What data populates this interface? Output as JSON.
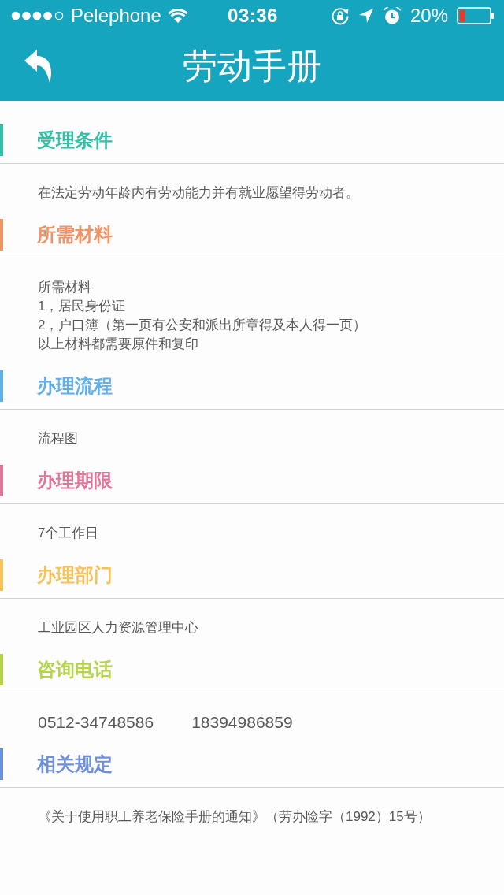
{
  "status_bar": {
    "carrier": "Pelephone",
    "time": "03:36",
    "battery": "20%"
  },
  "nav_bar": {
    "title": "劳动手册"
  },
  "sections": [
    {
      "title": "受理条件",
      "color": "#33bfa6",
      "kind": "text",
      "lines": [
        "在法定劳动年龄内有劳动能力并有就业愿望得劳动者。"
      ]
    },
    {
      "title": "所需材料",
      "color": "#f09466",
      "kind": "text",
      "lines": [
        "所需材料",
        "1，居民身份证",
        "2，户口簿（第一页有公安和派出所章得及本人得一页）",
        "以上材料都需要原件和复印"
      ]
    },
    {
      "title": "办理流程",
      "color": "#5fafe9",
      "kind": "text",
      "lines": [
        "流程图"
      ]
    },
    {
      "title": "办理期限",
      "color": "#df7597",
      "kind": "text",
      "lines": [
        "7个工作日"
      ]
    },
    {
      "title": "办理部门",
      "color": "#f5c35a",
      "kind": "text",
      "lines": [
        "工业园区人力资源管理中心"
      ]
    },
    {
      "title": "咨询电话",
      "color": "#b6d34e",
      "kind": "phones",
      "numbers": [
        "0512-34748586",
        "18394986859"
      ]
    },
    {
      "title": "相关规定",
      "color": "#6d8fdc",
      "kind": "text",
      "lines": [
        "《关于使用职工养老保险手册的通知》（劳办险字（1992）15号）"
      ]
    }
  ]
}
